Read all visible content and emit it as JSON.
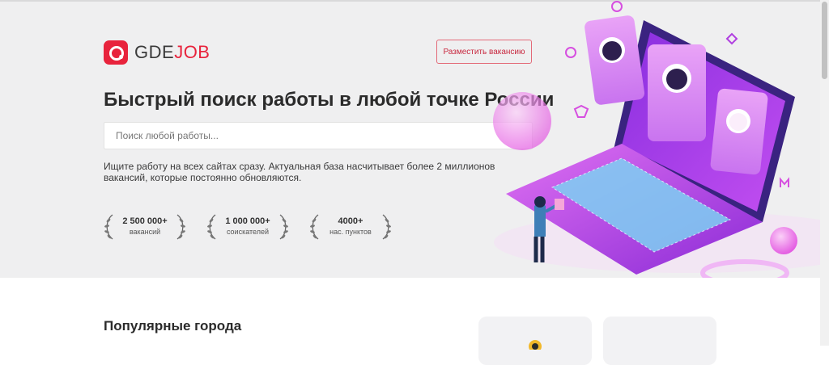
{
  "header": {
    "logo_part1": "GDE",
    "logo_part2": "JOB",
    "post_vacancy_label": "Разместить вакансию"
  },
  "hero": {
    "title": "Быстрый поиск работы в любой точке России",
    "search_placeholder": "Поиск любой работы...",
    "description": "Ищите работу на всех сайтах сразу. Актуальная база насчитывает более 2 миллионов вакансий, которые постоянно обновляются.",
    "stats": [
      {
        "value": "2 500 000+",
        "label": "вакансий"
      },
      {
        "value": "1 000 000+",
        "label": "соискателей"
      },
      {
        "value": "4000+",
        "label": "нас. пунктов"
      }
    ]
  },
  "sections": {
    "popular_cities_title": "Популярные города"
  },
  "colors": {
    "brand_red": "#e8233c",
    "hero_bg": "#efeff0",
    "accent_purple": "#a23cf0",
    "accent_pink": "#e45be6"
  },
  "icons": [
    "logo-icon",
    "laurel-left-icon",
    "laurel-right-icon",
    "laptop-illustration",
    "city-icon"
  ]
}
